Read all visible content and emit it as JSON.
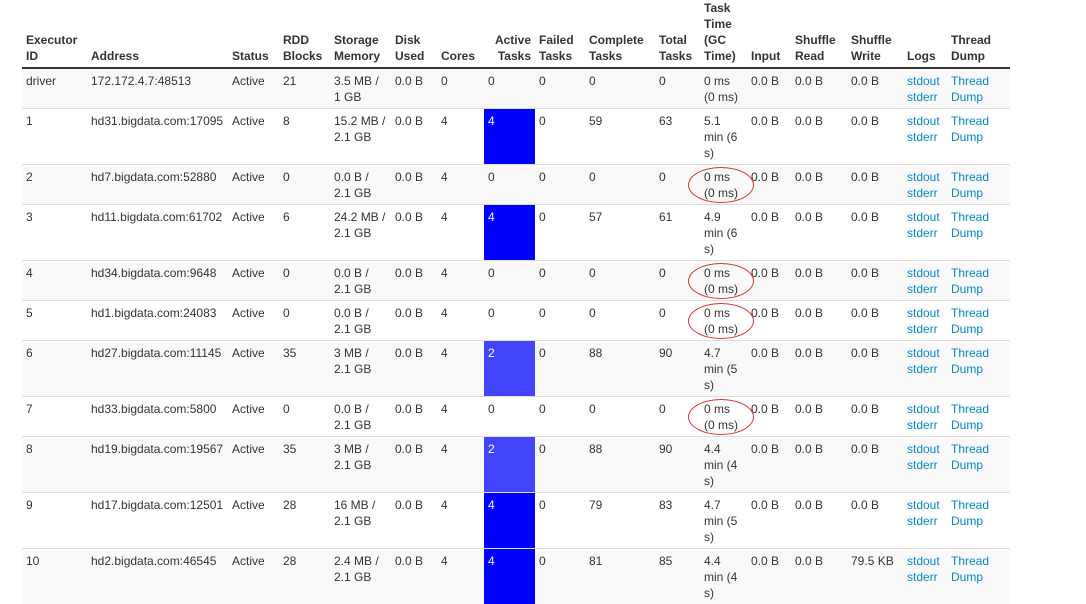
{
  "columns": [
    {
      "key": "id",
      "label": "Executor ID"
    },
    {
      "key": "address",
      "label": "Address"
    },
    {
      "key": "status",
      "label": "Status"
    },
    {
      "key": "rdd",
      "label": "RDD Blocks"
    },
    {
      "key": "storage",
      "label": "Storage Memory"
    },
    {
      "key": "disk",
      "label": "Disk Used"
    },
    {
      "key": "cores",
      "label": "Cores"
    },
    {
      "key": "active",
      "label": "Active Tasks"
    },
    {
      "key": "failed",
      "label": "Failed Tasks"
    },
    {
      "key": "complete",
      "label": "Complete Tasks"
    },
    {
      "key": "total",
      "label": "Total Tasks"
    },
    {
      "key": "time",
      "label": "Task Time (GC Time)"
    },
    {
      "key": "input",
      "label": "Input"
    },
    {
      "key": "shread",
      "label": "Shuffle Read"
    },
    {
      "key": "shwrite",
      "label": "Shuffle Write"
    },
    {
      "key": "logs",
      "label": "Logs"
    },
    {
      "key": "dump",
      "label": "Thread Dump"
    }
  ],
  "rows": [
    {
      "id": "driver",
      "address": "172.172.4.7:48513",
      "status": "Active",
      "rdd": "21",
      "storage": "3.5 MB / 1 GB",
      "disk": "0.0 B",
      "cores": "0",
      "active": "0",
      "failed": "0",
      "complete": "0",
      "total": "0",
      "time": "0 ms (0 ms)",
      "input": "0.0 B",
      "shread": "0.0 B",
      "shwrite": "0.0 B",
      "logs": [
        "stdout",
        "stderr"
      ],
      "dump": "Thread Dump",
      "load": 0,
      "circled": false
    },
    {
      "id": "1",
      "address": "hd31.bigdata.com:17095",
      "status": "Active",
      "rdd": "8",
      "storage": "15.2 MB / 2.1 GB",
      "disk": "0.0 B",
      "cores": "4",
      "active": "4",
      "failed": "0",
      "complete": "59",
      "total": "63",
      "time": "5.1 min (6 s)",
      "input": "0.0 B",
      "shread": "0.0 B",
      "shwrite": "0.0 B",
      "logs": [
        "stdout",
        "stderr"
      ],
      "dump": "Thread Dump",
      "load": 1,
      "circled": false
    },
    {
      "id": "2",
      "address": "hd7.bigdata.com:52880",
      "status": "Active",
      "rdd": "0",
      "storage": "0.0 B / 2.1 GB",
      "disk": "0.0 B",
      "cores": "4",
      "active": "0",
      "failed": "0",
      "complete": "0",
      "total": "0",
      "time": "0 ms (0 ms)",
      "input": "0.0 B",
      "shread": "0.0 B",
      "shwrite": "0.0 B",
      "logs": [
        "stdout",
        "stderr"
      ],
      "dump": "Thread Dump",
      "load": 0,
      "circled": true
    },
    {
      "id": "3",
      "address": "hd11.bigdata.com:61702",
      "status": "Active",
      "rdd": "6",
      "storage": "24.2 MB / 2.1 GB",
      "disk": "0.0 B",
      "cores": "4",
      "active": "4",
      "failed": "0",
      "complete": "57",
      "total": "61",
      "time": "4.9 min (6 s)",
      "input": "0.0 B",
      "shread": "0.0 B",
      "shwrite": "0.0 B",
      "logs": [
        "stdout",
        "stderr"
      ],
      "dump": "Thread Dump",
      "load": 1,
      "circled": false
    },
    {
      "id": "4",
      "address": "hd34.bigdata.com:9648",
      "status": "Active",
      "rdd": "0",
      "storage": "0.0 B / 2.1 GB",
      "disk": "0.0 B",
      "cores": "4",
      "active": "0",
      "failed": "0",
      "complete": "0",
      "total": "0",
      "time": "0 ms (0 ms)",
      "input": "0.0 B",
      "shread": "0.0 B",
      "shwrite": "0.0 B",
      "logs": [
        "stdout",
        "stderr"
      ],
      "dump": "Thread Dump",
      "load": 0,
      "circled": true
    },
    {
      "id": "5",
      "address": "hd1.bigdata.com:24083",
      "status": "Active",
      "rdd": "0",
      "storage": "0.0 B / 2.1 GB",
      "disk": "0.0 B",
      "cores": "4",
      "active": "0",
      "failed": "0",
      "complete": "0",
      "total": "0",
      "time": "0 ms (0 ms)",
      "input": "0.0 B",
      "shread": "0.0 B",
      "shwrite": "0.0 B",
      "logs": [
        "stdout",
        "stderr"
      ],
      "dump": "Thread Dump",
      "load": 0,
      "circled": true
    },
    {
      "id": "6",
      "address": "hd27.bigdata.com:11145",
      "status": "Active",
      "rdd": "35",
      "storage": "3 MB / 2.1 GB",
      "disk": "0.0 B",
      "cores": "4",
      "active": "2",
      "failed": "0",
      "complete": "88",
      "total": "90",
      "time": "4.7 min (5 s)",
      "input": "0.0 B",
      "shread": "0.0 B",
      "shwrite": "0.0 B",
      "logs": [
        "stdout",
        "stderr"
      ],
      "dump": "Thread Dump",
      "load": 0.5,
      "circled": false
    },
    {
      "id": "7",
      "address": "hd33.bigdata.com:5800",
      "status": "Active",
      "rdd": "0",
      "storage": "0.0 B / 2.1 GB",
      "disk": "0.0 B",
      "cores": "4",
      "active": "0",
      "failed": "0",
      "complete": "0",
      "total": "0",
      "time": "0 ms (0 ms)",
      "input": "0.0 B",
      "shread": "0.0 B",
      "shwrite": "0.0 B",
      "logs": [
        "stdout",
        "stderr"
      ],
      "dump": "Thread Dump",
      "load": 0,
      "circled": true
    },
    {
      "id": "8",
      "address": "hd19.bigdata.com:19567",
      "status": "Active",
      "rdd": "35",
      "storage": "3 MB / 2.1 GB",
      "disk": "0.0 B",
      "cores": "4",
      "active": "2",
      "failed": "0",
      "complete": "88",
      "total": "90",
      "time": "4.4 min (4 s)",
      "input": "0.0 B",
      "shread": "0.0 B",
      "shwrite": "0.0 B",
      "logs": [
        "stdout",
        "stderr"
      ],
      "dump": "Thread Dump",
      "load": 0.5,
      "circled": false
    },
    {
      "id": "9",
      "address": "hd17.bigdata.com:12501",
      "status": "Active",
      "rdd": "28",
      "storage": "16 MB / 2.1 GB",
      "disk": "0.0 B",
      "cores": "4",
      "active": "4",
      "failed": "0",
      "complete": "79",
      "total": "83",
      "time": "4.7 min (5 s)",
      "input": "0.0 B",
      "shread": "0.0 B",
      "shwrite": "0.0 B",
      "logs": [
        "stdout",
        "stderr"
      ],
      "dump": "Thread Dump",
      "load": 1,
      "circled": false
    },
    {
      "id": "10",
      "address": "hd2.bigdata.com:46545",
      "status": "Active",
      "rdd": "28",
      "storage": "2.4 MB / 2.1 GB",
      "disk": "0.0 B",
      "cores": "4",
      "active": "4",
      "failed": "0",
      "complete": "81",
      "total": "85",
      "time": "4.4 min (4 s)",
      "input": "0.0 B",
      "shread": "0.0 B",
      "shwrite": "79.5 KB",
      "logs": [
        "stdout",
        "stderr"
      ],
      "dump": "Thread Dump",
      "load": 1,
      "circled": false
    }
  ],
  "colors": {
    "active_full": "#0000ff",
    "active_half": "#4444ff",
    "link": "#0088cc",
    "annotation": "#e03030"
  }
}
